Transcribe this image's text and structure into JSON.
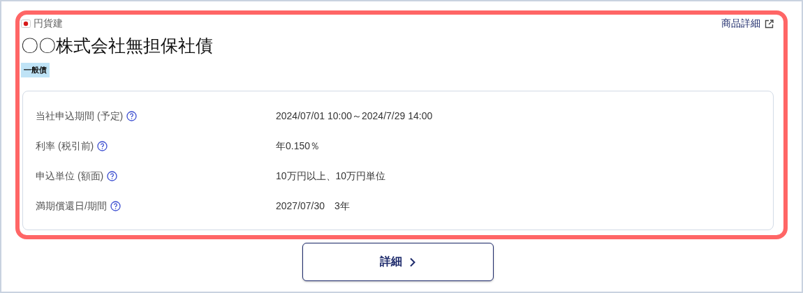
{
  "card": {
    "currency": "円貨建",
    "product_link": "商品詳細",
    "title": "〇〇株式会社無担保社債",
    "tag": "一般債",
    "rows": [
      {
        "label": "当社申込期間 (予定)",
        "value": "2024/07/01 10:00～2024/7/29 14:00"
      },
      {
        "label": "利率 (税引前)",
        "value": "年0.150％"
      },
      {
        "label": "申込単位 (額面)",
        "value": "10万円以上、10万円単位"
      },
      {
        "label": "満期償還日/期間",
        "value": "2027/07/30　3年"
      }
    ]
  },
  "button": {
    "label": "詳細"
  }
}
